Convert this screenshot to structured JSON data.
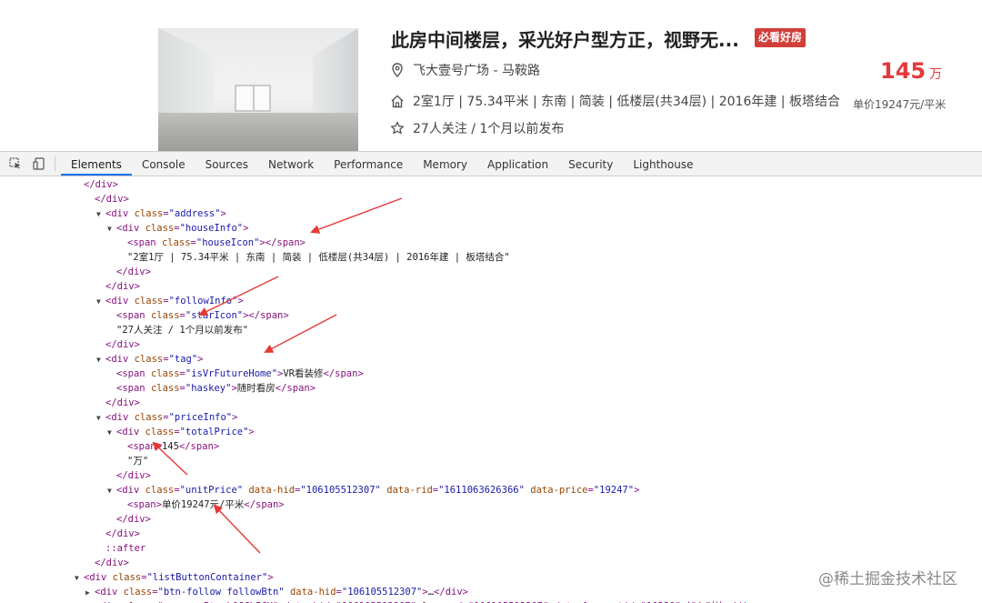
{
  "listing": {
    "title": "此房中间楼层，采光好户型方正，视野无...",
    "badge": "必看好房",
    "address": "飞大壹号广场 - 马鞍路",
    "house_info": "2室1厅 | 75.34平米 | 东南 | 简装 | 低楼层(共34层) | 2016年建 | 板塔结合",
    "follow_info": "27人关注 / 1个月以前发布",
    "total_price": "145",
    "price_unit": "万",
    "unit_price": "单价19247元/平米"
  },
  "devtools": {
    "tabs": [
      "Elements",
      "Console",
      "Sources",
      "Network",
      "Performance",
      "Memory",
      "Application",
      "Security",
      "Lighthouse"
    ],
    "active_tab": "Elements"
  },
  "dom_lines": [
    {
      "close": "div",
      "indent": 0
    },
    {
      "close": "div",
      "indent": 1
    },
    {
      "open": "div",
      "cls": "address",
      "indent": 2
    },
    {
      "open": "div",
      "cls": "houseInfo",
      "indent": 3
    },
    {
      "span": "houseIcon",
      "indent": 4
    },
    {
      "text": "\"2室1厅 | 75.34平米 | 东南 | 简装 | 低楼层(共34层) | 2016年建 | 板塔结合\"",
      "indent": 4
    },
    {
      "close": "div",
      "indent": 3
    },
    {
      "close": "div",
      "indent": 2
    },
    {
      "open": "div",
      "cls": "followInfo",
      "indent": 2
    },
    {
      "span": "starIcon",
      "indent": 3
    },
    {
      "text": "\"27人关注 / 1个月以前发布\"",
      "indent": 3
    },
    {
      "close": "div",
      "indent": 2
    },
    {
      "open": "div",
      "cls": "tag",
      "indent": 2
    },
    {
      "spanText": "isVrFutureHome",
      "inner": "VR看装修",
      "indent": 3
    },
    {
      "spanText": "haskey",
      "inner": "随时看房",
      "indent": 3
    },
    {
      "close": "div",
      "indent": 2
    },
    {
      "open": "div",
      "cls": "priceInfo",
      "indent": 2
    },
    {
      "open": "div",
      "cls": "totalPrice",
      "indent": 3
    },
    {
      "plainSpan": "145",
      "indent": 4
    },
    {
      "text": "\"万\"",
      "indent": 4
    },
    {
      "close": "div",
      "indent": 3
    },
    {
      "unitPrice": true,
      "indent": 3
    },
    {
      "plainSpan": "单价19247元/平米",
      "indent": 4
    },
    {
      "close": "div",
      "indent": 3
    },
    {
      "close": "div",
      "indent": 2
    },
    {
      "pseudo": "::after",
      "indent": 2
    },
    {
      "close": "div",
      "indent": 1
    },
    {
      "open": "div",
      "cls": "listButtonContainer",
      "indent": 0
    },
    {
      "btnFollow": true,
      "indent": 1
    },
    {
      "truncated": "<div class=\"compareBtn LOGCLICK\" data-hid=\"106105512307\" log-mod=\"106105512307\" data-log_evtid=\"10230\">加入对比</div>",
      "indent": 1
    }
  ],
  "unit_price_attrs": {
    "hid": "106105512307",
    "rid": "1611063626366",
    "price": "19247"
  },
  "follow_hid": "106105512307",
  "watermark": "@稀土掘金技术社区"
}
